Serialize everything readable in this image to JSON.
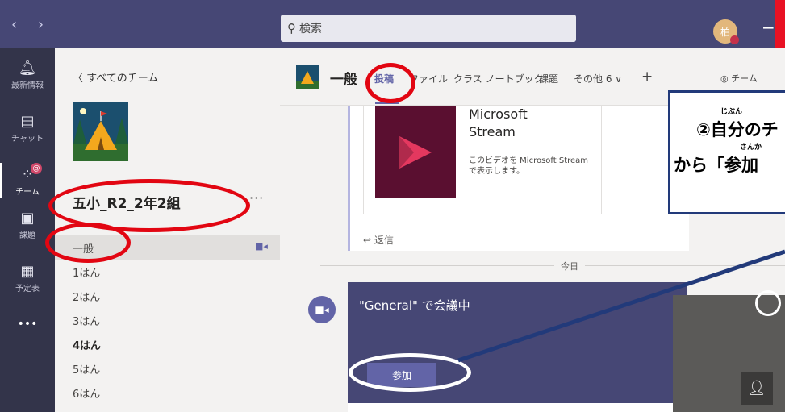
{
  "app": {
    "search_placeholder": "検索",
    "avatar_initial": "柏",
    "minimize_glyph": "−"
  },
  "rail": [
    {
      "label": "最新情報",
      "icon": "bell-icon"
    },
    {
      "label": "チャット",
      "icon": "chat-icon"
    },
    {
      "label": "チーム",
      "icon": "teams-icon",
      "badge": "@"
    },
    {
      "label": "課題",
      "icon": "assignments-icon"
    },
    {
      "label": "予定表",
      "icon": "calendar-icon"
    },
    {
      "label": "•••",
      "icon": "more-apps-icon"
    }
  ],
  "team_panel": {
    "back": "〈  すべてのチーム",
    "team_name": "五小_R2_2年2組",
    "more": "···",
    "channels": [
      "一般",
      "1はん",
      "2はん",
      "3はん",
      "4はん",
      "5はん",
      "6はん"
    ],
    "selected_channel": "一般",
    "bold_channel": "4はん"
  },
  "header": {
    "channel_name": "一般",
    "tabs": [
      "投稿",
      "ファイル",
      "クラス ノートブック",
      "課題",
      "その他 6 ∨",
      "+"
    ],
    "active_tab": "投稿",
    "team_button": "◎ チーム"
  },
  "feed": {
    "stream_title_1": "Microsoft",
    "stream_title_2": "Stream",
    "stream_desc": "このビデオを Microsoft Stream で表示します。",
    "reply": "↩ 返信",
    "date_divider": "今日",
    "meeting_title": "\"General\" で会議中",
    "join_button": "参加"
  },
  "annotation": {
    "line1": "②自分のチ",
    "line2": "から「参加",
    "ruby_jibun": "じぶん",
    "ruby_sanka": "さんか"
  },
  "colors": {
    "brand": "#464775",
    "accent": "#6264a7",
    "rail": "#33344a",
    "annotation_red": "#e20612",
    "annotation_border": "#223a7a"
  }
}
